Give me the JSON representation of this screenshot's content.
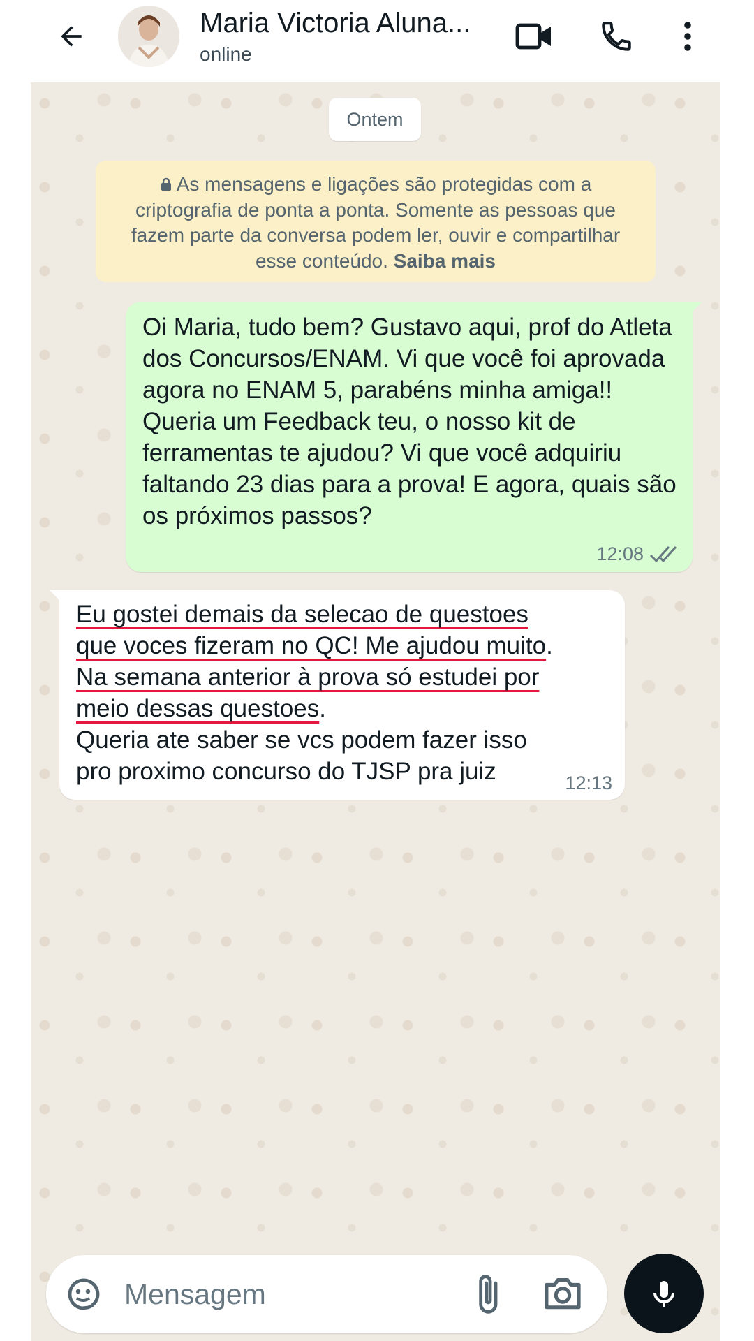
{
  "header": {
    "contact_name": "Maria Victoria Aluna...",
    "status": "online",
    "icons": {
      "back": "back-arrow-icon",
      "video": "video-call-icon",
      "voice": "phone-icon",
      "menu": "more-vertical-icon"
    }
  },
  "chat": {
    "date_chip": "Ontem",
    "encryption_notice": {
      "text": "As mensagens e ligações são protegidas com a criptografia de ponta a ponta. Somente as pessoas que fazem parte da conversa podem ler, ouvir e compartilhar esse conteúdo.",
      "link": "Saiba mais"
    },
    "messages": [
      {
        "direction": "outgoing",
        "text": "Oi Maria, tudo bem? Gustavo aqui, prof do Atleta dos Concursos/ENAM. Vi que você foi aprovada agora no ENAM 5, parabéns minha amiga!! Queria um Feedback teu, o nosso kit de ferramentas te ajudou? Vi que você adquiriu faltando 23 dias para a prova! E agora, quais são os próximos passos?",
        "time": "12:08",
        "status": "read"
      },
      {
        "direction": "incoming",
        "lines": [
          "Eu gostei demais da selecao de questoes",
          "que voces fizeram no QC! Me ajudou muito",
          ".",
          "Na semana anterior à prova só estudei por",
          "meio dessas questoes",
          "Queria ate saber se vcs podem fazer isso",
          "pro proximo concurso do TJSP pra juiz"
        ],
        "time": "12:13"
      }
    ]
  },
  "composer": {
    "placeholder": "Mensagem",
    "icons": {
      "emoji": "sticker-emoji-icon",
      "attach": "paperclip-icon",
      "camera": "camera-icon",
      "mic": "microphone-icon"
    }
  },
  "colors": {
    "chat_background": "#efeae2",
    "outgoing_bubble": "#d9fdd3",
    "incoming_bubble": "#ffffff",
    "encryption_notice_bg": "#fcf0c8",
    "mic_button": "#0b141a",
    "spellcheck_underline": "#e4183c"
  }
}
